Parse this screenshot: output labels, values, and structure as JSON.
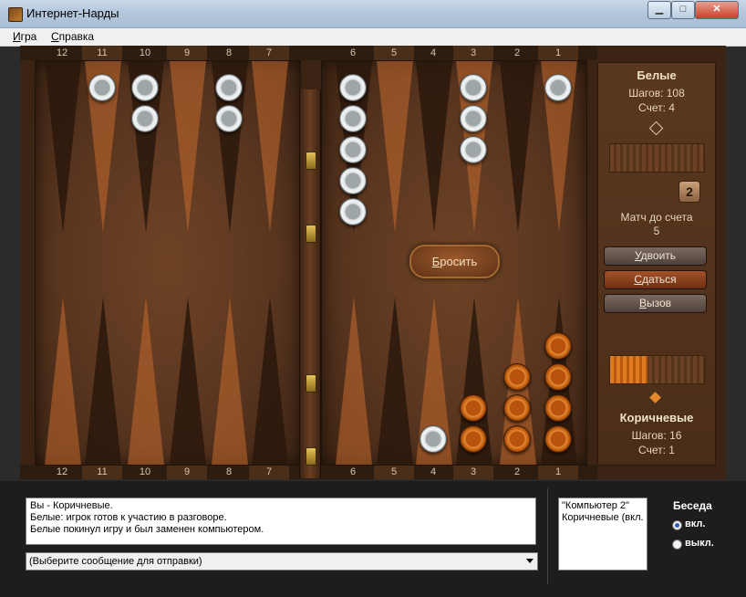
{
  "window": {
    "title": "Интернет-Нарды",
    "minimize_glyph": "▁",
    "maximize_glyph": "□",
    "close_glyph": "✕"
  },
  "menu": {
    "game": "Игра",
    "help": "Справка"
  },
  "board": {
    "top_numbers": [
      "12",
      "11",
      "10",
      "9",
      "8",
      "7",
      "6",
      "5",
      "4",
      "3",
      "2",
      "1"
    ],
    "bottom_numbers": [
      "12",
      "11",
      "10",
      "9",
      "8",
      "7",
      "6",
      "5",
      "4",
      "3",
      "2",
      "1"
    ],
    "roll_button": "Бросить",
    "colors": {
      "white_checker": "#e8ecec",
      "brown_checker": "#d46a16",
      "board_wood": "#5a3620"
    },
    "checkers_top": [
      {
        "point": 11,
        "color": "white",
        "count": 1
      },
      {
        "point": 10,
        "color": "white",
        "count": 2
      },
      {
        "point": 8,
        "color": "white",
        "count": 2
      },
      {
        "point": 6,
        "color": "white",
        "count": 5
      },
      {
        "point": 3,
        "color": "white",
        "count": 3
      },
      {
        "point": 1,
        "color": "white",
        "count": 1
      }
    ],
    "checkers_bottom": [
      {
        "point": 4,
        "color": "white",
        "count": 1
      },
      {
        "point": 3,
        "color": "brown",
        "count": 2
      },
      {
        "point": 2,
        "color": "brown",
        "count": 3
      },
      {
        "point": 1,
        "color": "brown",
        "count": 4
      }
    ]
  },
  "panel": {
    "white": {
      "name": "Белые",
      "steps": "Шагов: 108",
      "score": "Счет: 4"
    },
    "brown": {
      "name": "Коричневые",
      "steps": "Шагов: 16",
      "score": "Счет: 1"
    },
    "doubling_cube": "2",
    "match_label": "Матч до счета",
    "match_value": "5",
    "buttons": {
      "double": "Удвоить",
      "resign": "Сдаться",
      "challenge": "Вызов"
    },
    "brown_meter_fraction": 0.4
  },
  "chat": {
    "log": [
      "Вы - Коричневые.",
      "Белые: игрок готов к участию в разговоре.",
      "Белые покинул игру и был заменен компьютером."
    ],
    "select_placeholder": "(Выберите сообщение для отправки)",
    "players": [
      "\"Компьютер 2\"",
      "Коричневые (вкл."
    ],
    "title": "Беседа",
    "on_label": "вкл.",
    "off_label": "выкл."
  }
}
